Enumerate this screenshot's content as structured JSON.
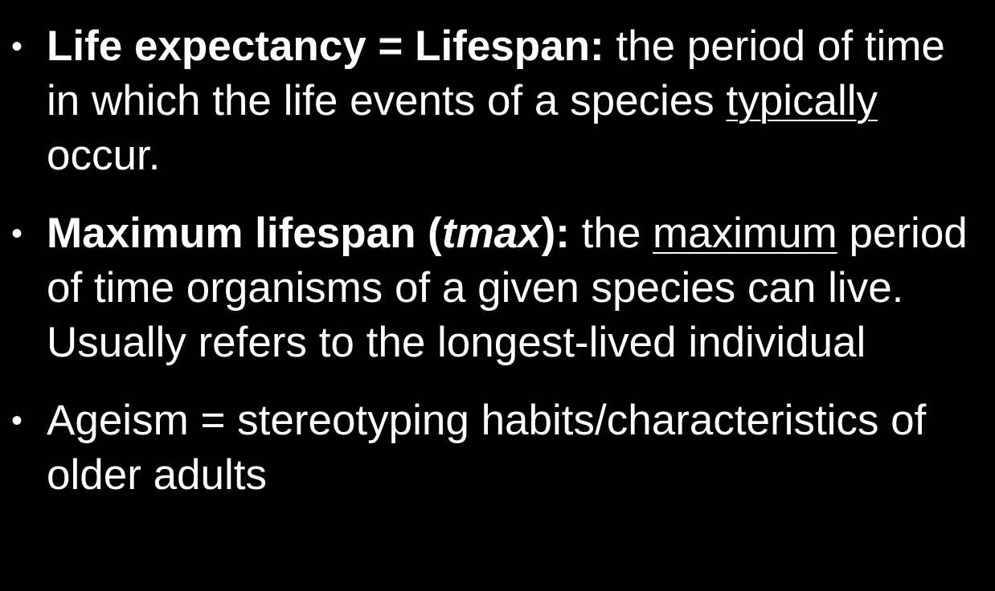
{
  "slide": {
    "bullet_symbol": "•",
    "items": [
      {
        "term": "Life expectancy = Lifespan:",
        "text_before": " the period of time in which the life events of a species ",
        "emphasis": "typically",
        "text_after": " occur."
      },
      {
        "term_start": "Maximum lifespan (",
        "term_italic": "tmax",
        "term_end": "):",
        "text_before": " the ",
        "emphasis": "maximum",
        "text_after": " period of time organisms of a given species can live. Usually refers to the longest-lived individual"
      },
      {
        "text": "Ageism = stereotyping habits/characteristics of older adults"
      }
    ]
  }
}
